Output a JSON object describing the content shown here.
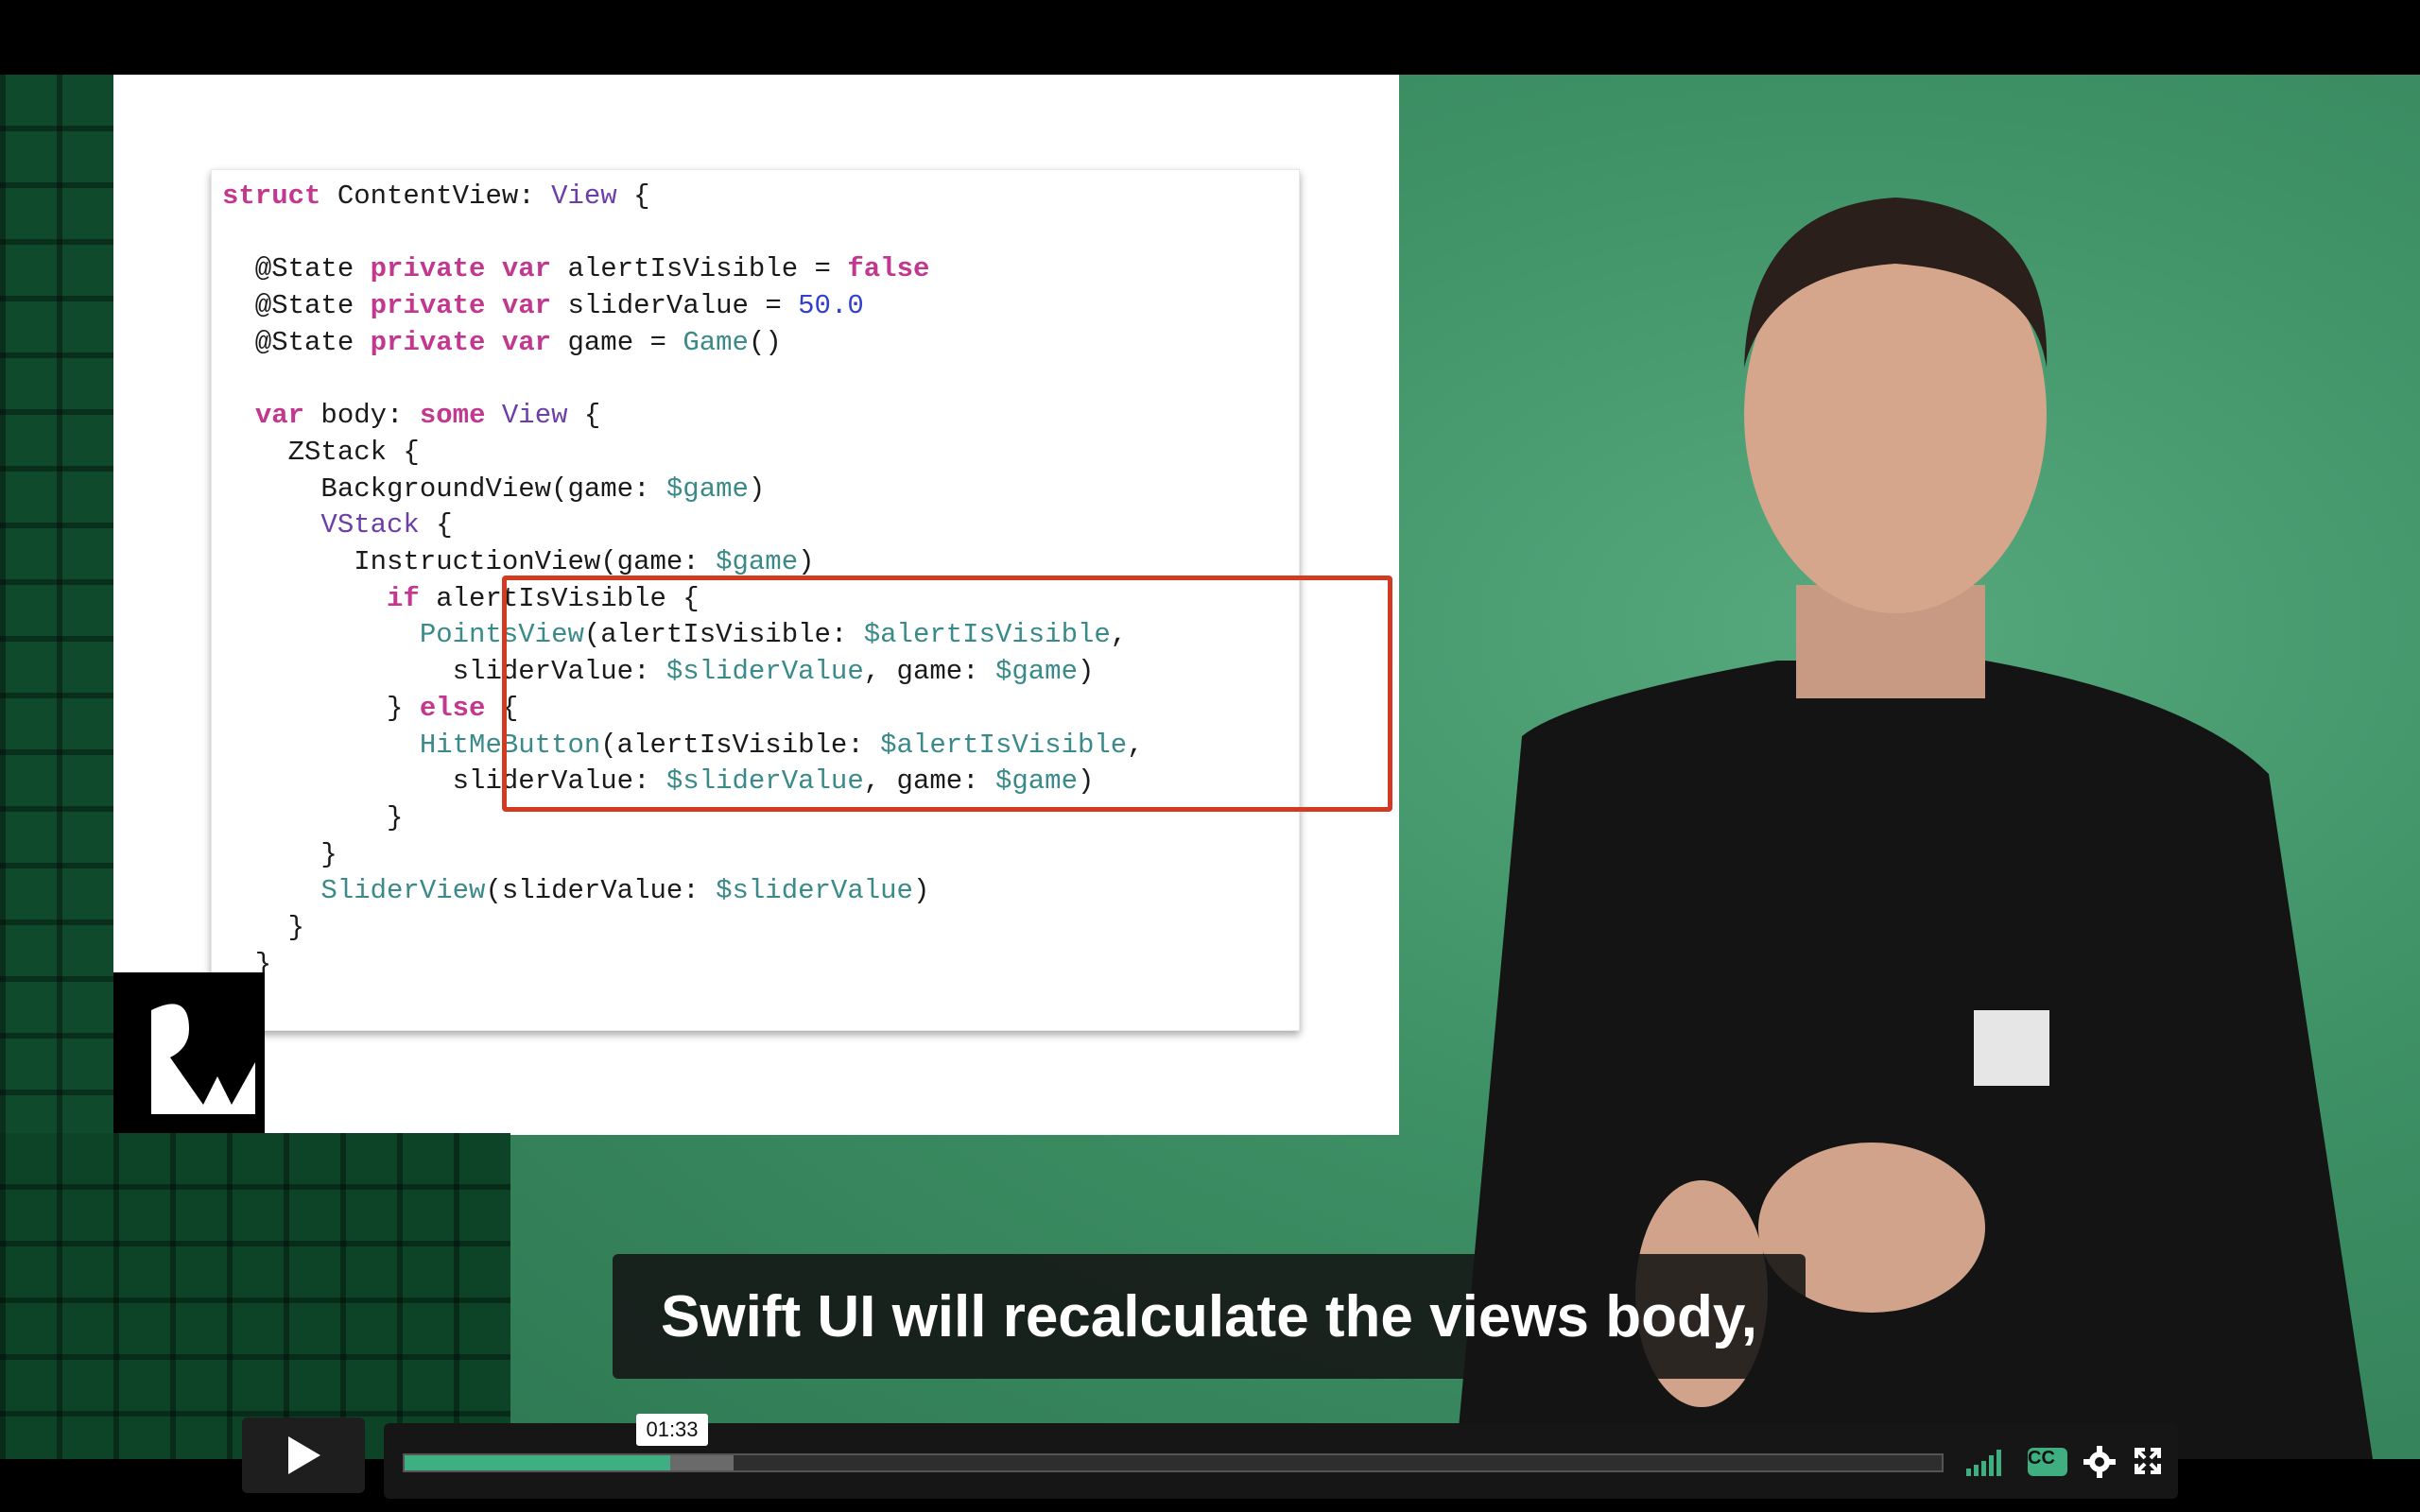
{
  "slide": {
    "code_lines": [
      "struct ContentView: View {",
      "",
      "  @State private var alertIsVisible = false",
      "  @State private var sliderValue = 50.0",
      "  @State private var game = Game()",
      "",
      "  var body: some View {",
      "    ZStack {",
      "      BackgroundView(game: $game)",
      "      VStack {",
      "        InstructionView(game: $game)",
      "          if alertIsVisible {",
      "            PointsView(alertIsVisible: $alertIsVisible,",
      "              sliderValue: $sliderValue, game: $game)",
      "          } else {",
      "            HitMeButton(alertIsVisible: $alertIsVisible,",
      "              sliderValue: $sliderValue, game: $game)",
      "          }",
      "      }",
      "      SliderView(sliderValue: $sliderValue)",
      "    }",
      "  }",
      "}"
    ]
  },
  "subtitle": "Swift UI will recalculate the views body,",
  "player": {
    "current_time": "01:33",
    "played_fraction": 0.173,
    "buffered_fraction": 0.214,
    "icons": [
      "play-icon",
      "volume-icon",
      "cc-icon",
      "settings-icon",
      "fullscreen-icon"
    ],
    "cc_label": "CC",
    "accent_color": "#3fae80"
  }
}
